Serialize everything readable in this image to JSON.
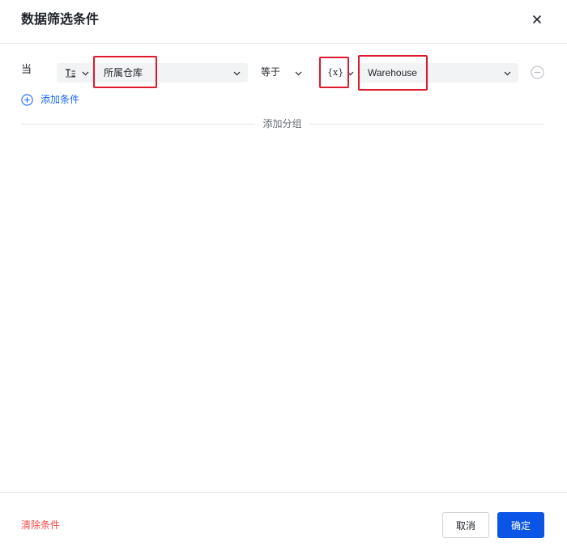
{
  "dialog": {
    "title": "数据筛选条件",
    "close_icon": "close-icon"
  },
  "condition": {
    "when_label": "当",
    "field_type_icon": "text-type-icon",
    "field": "所属仓库",
    "operator": "等于",
    "value_mode_label": "{x}",
    "value": "Warehouse",
    "remove_icon": "minus-circle-icon"
  },
  "actions": {
    "add_condition": "添加条件",
    "add_condition_icon": "plus-circle-icon",
    "add_group": "添加分组"
  },
  "footer": {
    "clear": "清除条件",
    "cancel": "取消",
    "confirm": "确定"
  },
  "colors": {
    "accent": "#0a55e6",
    "link": "#1664ff",
    "danger": "#f54a45",
    "highlight": "#e0182d",
    "field_bg": "#f2f3f5"
  }
}
